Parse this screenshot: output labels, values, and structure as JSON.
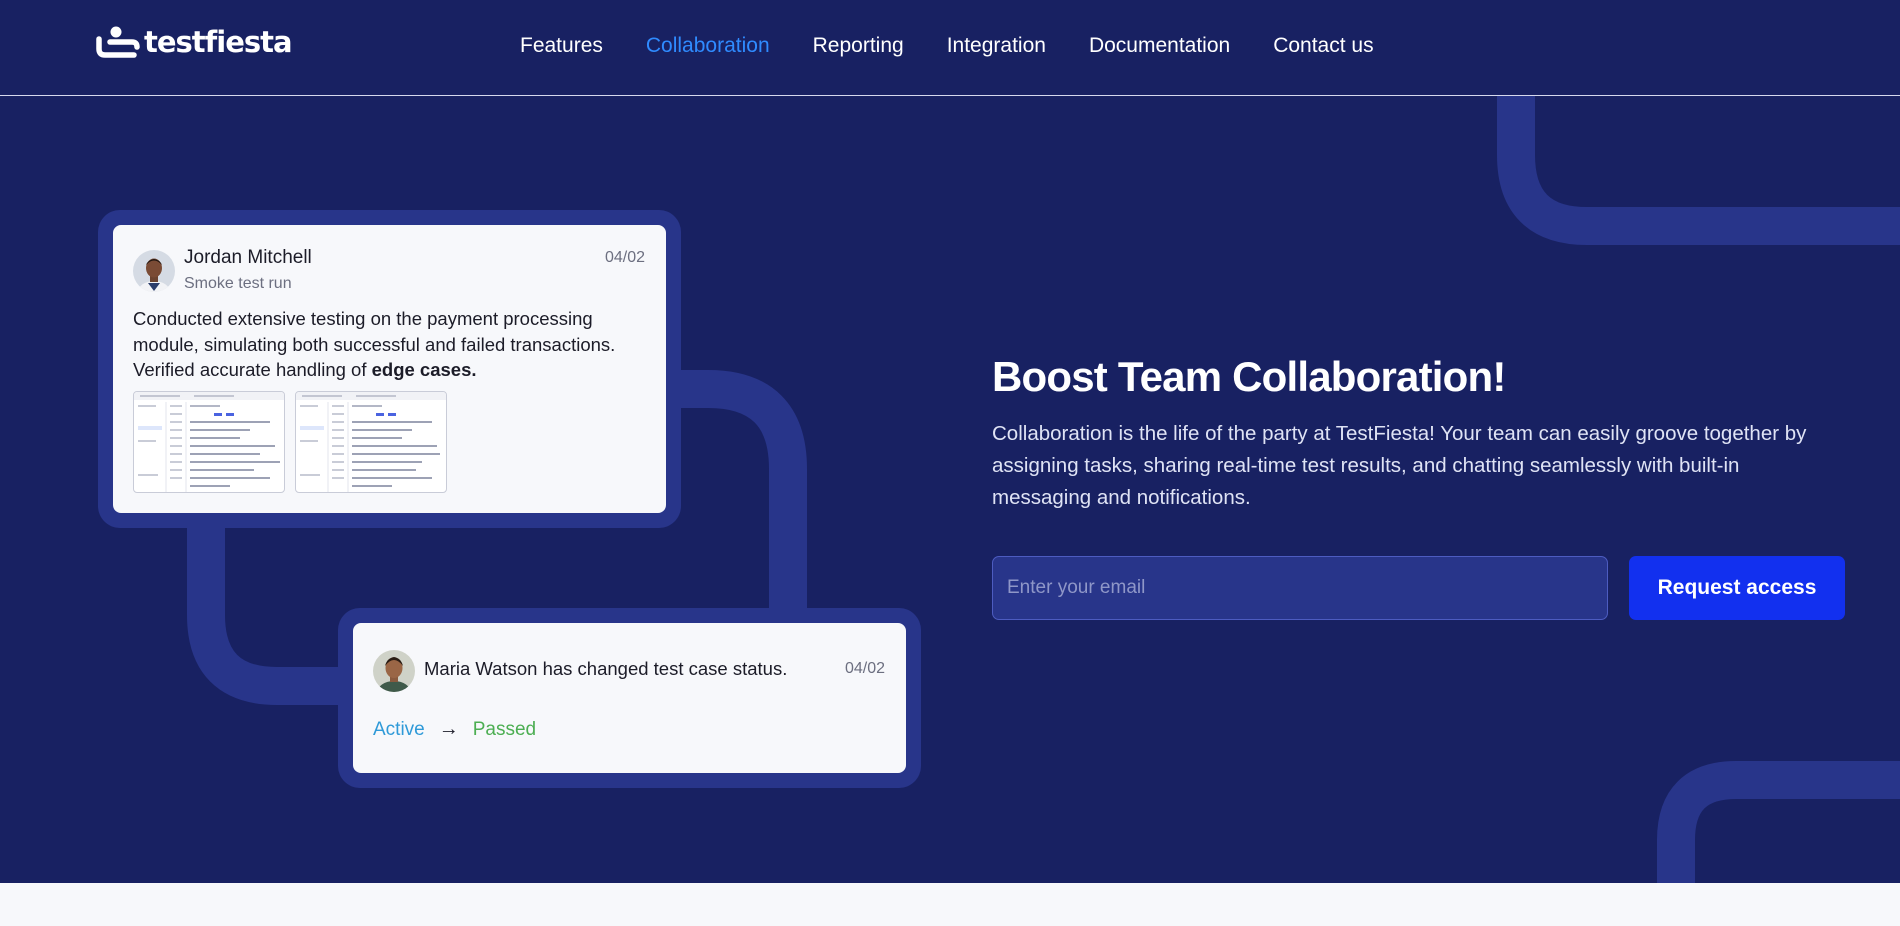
{
  "brand": {
    "logo_text": "testfiesta",
    "logo_icon": "testfiesta-logo-icon"
  },
  "nav": {
    "items": [
      {
        "label": "Features",
        "active": false
      },
      {
        "label": "Collaboration",
        "active": true
      },
      {
        "label": "Reporting",
        "active": false
      },
      {
        "label": "Integration",
        "active": false
      },
      {
        "label": "Documentation",
        "active": false
      },
      {
        "label": "Contact us",
        "active": false
      }
    ]
  },
  "comment_card": {
    "author": "Jordan Mitchell",
    "subtitle": "Smoke test run",
    "date": "04/02",
    "body_text": "Conducted extensive testing on the payment processing module, simulating both successful and failed transactions. Verified accurate handling of ",
    "body_bold": "edge cases."
  },
  "status_card": {
    "message": "Maria Watson has changed test case status.",
    "date": "04/02",
    "from_status": "Active",
    "to_status": "Passed",
    "arrow_icon": "arrow-right-icon"
  },
  "hero": {
    "headline": "Boost Team Collaboration!",
    "description": "Collaboration is the life of the party at TestFiesta! Your team can easily groove together by assigning tasks, sharing real-time test results, and chatting seamlessly with built-in messaging and notifications."
  },
  "signup": {
    "email_placeholder": "Enter your email",
    "button_label": "Request access"
  },
  "colors": {
    "background": "#182162",
    "accent_nav": "#2f8bff",
    "button": "#1230ef",
    "status_active": "#2f9ad8",
    "status_passed": "#4cae52"
  }
}
